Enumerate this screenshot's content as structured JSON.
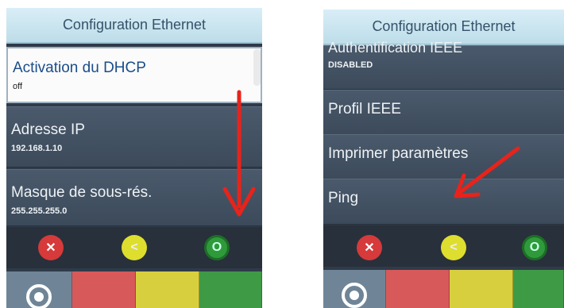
{
  "left_screen": {
    "title": "Configuration Ethernet",
    "items": [
      {
        "label": "Activation du DHCP",
        "value": "off"
      },
      {
        "label": "Adresse IP",
        "value": "192.168.1.10"
      },
      {
        "label": "Masque de sous-rés.",
        "value": "255.255.255.0"
      }
    ],
    "softkeys": [
      {
        "icon": "close-icon",
        "glyph": "✕"
      },
      {
        "icon": "back-icon",
        "glyph": "<"
      },
      {
        "icon": "ok-icon",
        "glyph": "O"
      }
    ]
  },
  "right_screen": {
    "title": "Configuration Ethernet",
    "items": [
      {
        "label": "Authentification IEEE",
        "value": "DISABLED"
      },
      {
        "label": "Profil IEEE",
        "value": ""
      },
      {
        "label": "Imprimer paramètres",
        "value": ""
      },
      {
        "label": "Ping",
        "value": ""
      }
    ],
    "softkeys": [
      {
        "icon": "close-icon",
        "glyph": "✕"
      },
      {
        "icon": "back-icon",
        "glyph": "<"
      },
      {
        "icon": "ok-icon",
        "glyph": "O"
      }
    ]
  },
  "annotation_colors": {
    "arrow": "#e8231b"
  }
}
